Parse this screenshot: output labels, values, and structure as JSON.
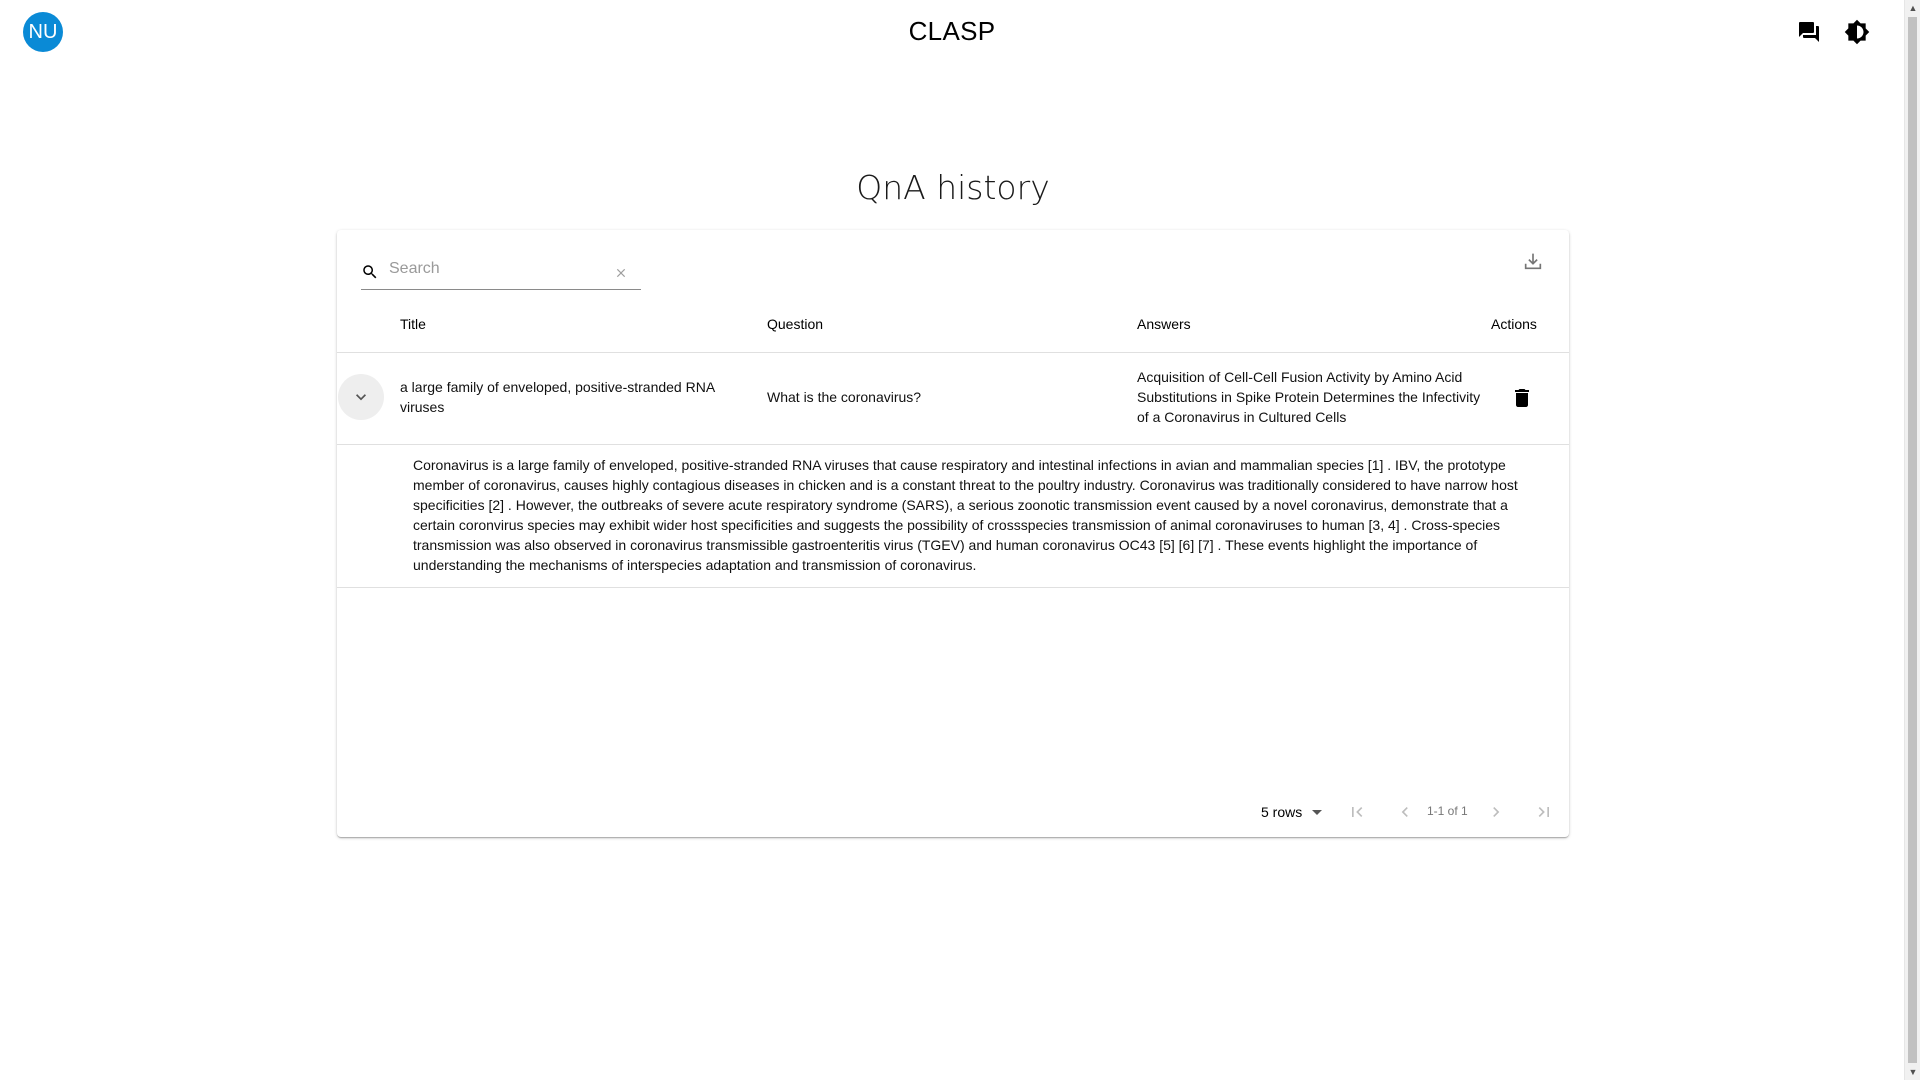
{
  "app": {
    "avatar_initials": "NU",
    "title": "CLASP",
    "icons": {
      "chat": "chat-icon",
      "theme": "brightness-icon"
    },
    "accent_color": "#0a8ad6"
  },
  "page": {
    "heading": "QnA history"
  },
  "search": {
    "placeholder": "Search",
    "value": ""
  },
  "table": {
    "columns": [
      "Title",
      "Question",
      "Answers",
      "Actions"
    ],
    "rows": [
      {
        "title": "a large family of enveloped, positive-stranded RNA viruses",
        "question": "What is the coronavirus?",
        "answer": "Acquisition of Cell-Cell Fusion Activity by Amino Acid Substitutions in Spike Protein Determines the Infectivity of a Coronavirus in Cultured Cells",
        "expanded": true,
        "detail": "Coronavirus is a large family of enveloped, positive-stranded RNA viruses that cause respiratory and intestinal infections in avian and mammalian species [1] . IBV, the prototype member of coronavirus, causes highly contagious diseases in chicken and is a constant threat to the poultry industry. Coronavirus was traditionally considered to have narrow host specificities [2] . However, the outbreaks of severe acute respiratory syndrome (SARS), a serious zoonotic transmission event caused by a novel coronavirus, demonstrate that a certain coronvirus species may exhibit wider host specificities and suggests the possibility of crossspecies transmission of animal coronaviruses to human [3, 4] . Cross-species transmission was also observed in coronavirus transmissible gastroenteritis virus (TGEV) and human coronavirus OC43 [5] [6] [7] . These events highlight the importance of understanding the mechanisms of interspecies adaptation and transmission of coronavirus."
      }
    ]
  },
  "pagination": {
    "rows_per_page": "5 rows",
    "range": "1-1 of 1"
  }
}
